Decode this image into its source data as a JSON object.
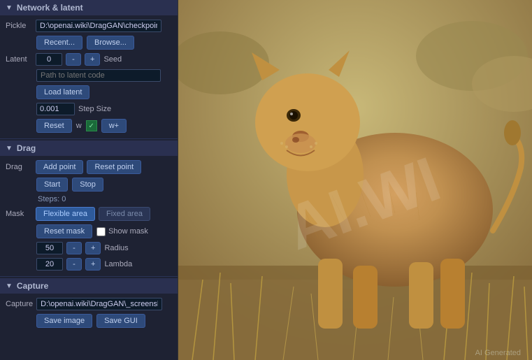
{
  "network_section": {
    "header": "Network & latent",
    "pickle_label": "Pickle",
    "pickle_path": "D:\\openai.wiki\\DragGAN\\checkpoints",
    "recent_btn": "Recent...",
    "browse_btn": "Browse...",
    "latent_label": "Latent",
    "latent_value": "0",
    "latent_minus": "-",
    "latent_plus": "+",
    "seed_label": "Seed",
    "latent_path_placeholder": "Path to latent code",
    "load_latent_btn": "Load latent",
    "step_size_value": "0.001",
    "step_size_label": "Step Size",
    "reset_btn": "Reset",
    "w_label": "w",
    "w_plus_label": "w+"
  },
  "drag_section": {
    "header": "Drag",
    "drag_label": "Drag",
    "add_point_btn": "Add point",
    "reset_point_btn": "Reset point",
    "start_btn": "Start",
    "stop_btn": "Stop",
    "steps_label": "Steps: 0",
    "mask_label": "Mask",
    "flexible_area_btn": "Flexible area",
    "fixed_area_btn": "Fixed area",
    "reset_mask_btn": "Reset mask",
    "show_mask_label": "Show mask",
    "radius_value": "50",
    "radius_minus": "-",
    "radius_plus": "+",
    "radius_label": "Radius",
    "lambda_value": "20",
    "lambda_minus": "-",
    "lambda_plus": "+",
    "lambda_label": "Lambda"
  },
  "capture_section": {
    "header": "Capture",
    "capture_label": "Capture",
    "capture_path": "D:\\openai.wiki\\DragGAN\\_screenshot",
    "save_image_btn": "Save image",
    "save_gui_btn": "Save GUI"
  },
  "image": {
    "watermark": "AI.WI",
    "ai_generated": "AI Generated"
  }
}
